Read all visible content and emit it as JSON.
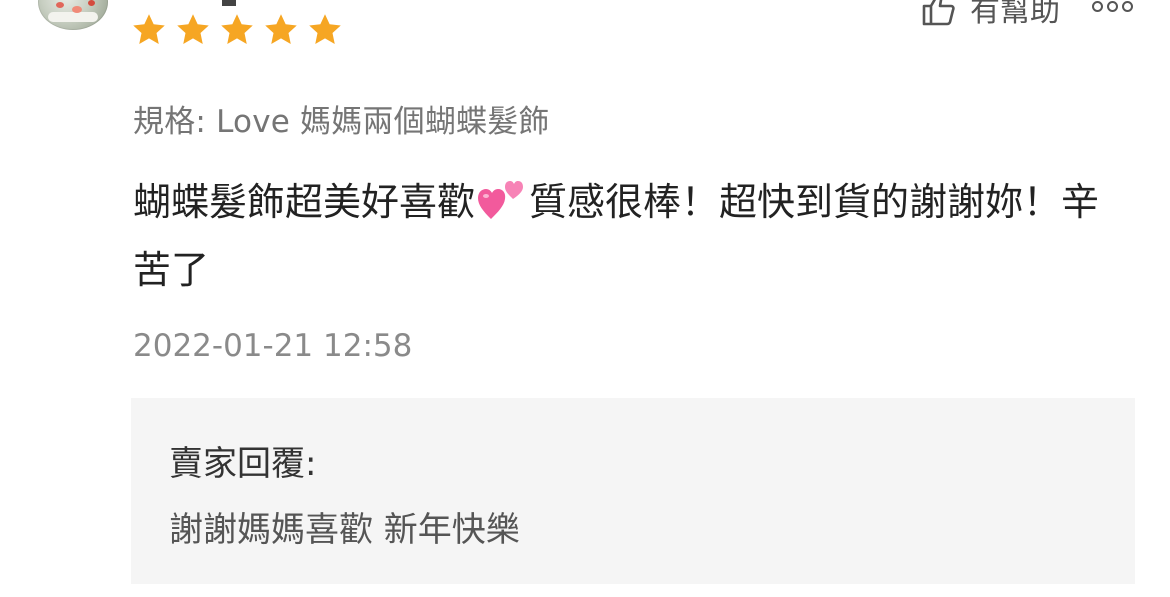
{
  "review": {
    "rating": 5,
    "rating_max": 5,
    "star_color": "#F6A623",
    "helpful_label": "有幫助",
    "icons": {
      "helpful": "thumbs-up-icon",
      "more": "more-options-icon"
    },
    "spec": "規格: Love 媽媽兩個蝴蝶髮飾",
    "comment_part1": "蝴蝶髮飾超美好喜歡",
    "comment_emoji": "💕",
    "comment_part2": "質感很棒！超快到貨的謝謝妳！辛苦了",
    "timestamp": "2022-01-21 12:58"
  },
  "seller_reply": {
    "label": "賣家回覆:",
    "text": "謝謝媽媽喜歡 新年快樂"
  }
}
